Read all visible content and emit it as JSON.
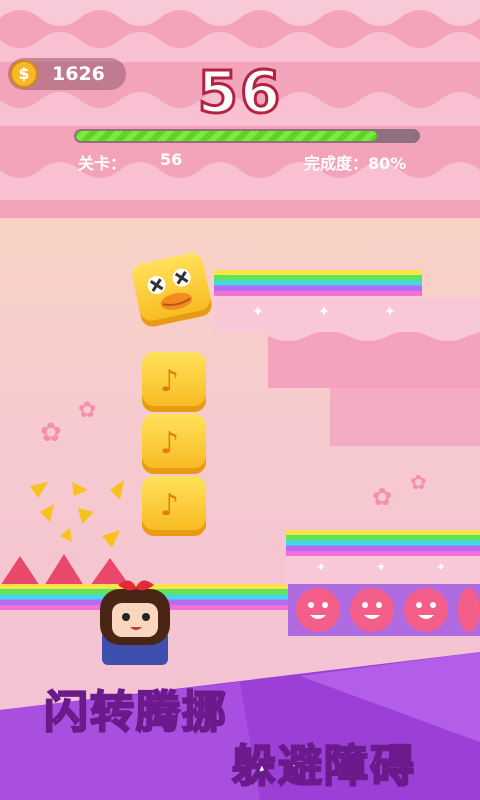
{
  "hud": {
    "coins": "1626",
    "coin_symbol": "$",
    "score": "56",
    "progress": 0.88,
    "level_label": "关卡：",
    "level_value": "56",
    "completion": "完成度：80%"
  },
  "slogan": {
    "line1": "闪转腾挪",
    "line2": "躲避障碍"
  },
  "colors": {
    "header_pink": "#f3a4bb",
    "score_stroke": "#b3223f",
    "progress_green": "#5cd420",
    "block_yellow": "#f7b81e",
    "obstacle_purple": "#b06ae0",
    "face_pink": "#f45f8a"
  },
  "icons": [
    "coin-icon",
    "music-note-icon",
    "cherry-blossom-icon",
    "sparkle-icon"
  ]
}
